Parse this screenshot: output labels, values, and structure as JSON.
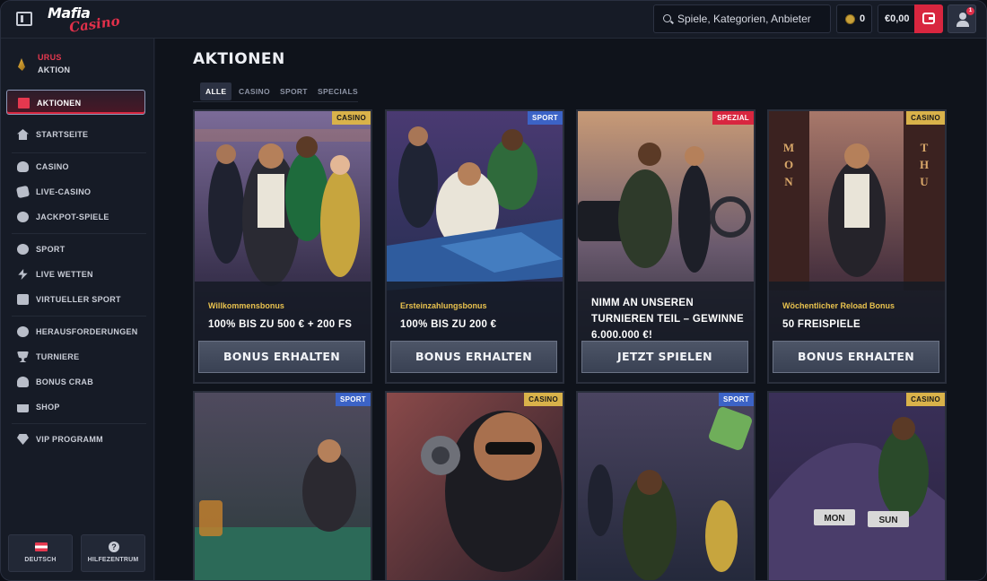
{
  "header": {
    "logo_main": "Mafia",
    "logo_script": "Casino",
    "search_placeholder": "Spiele, Kategorien, Anbieter",
    "coins": "0",
    "balance": "€0,00",
    "notification_count": "1"
  },
  "sidebar": {
    "promo": {
      "top": "URUS",
      "bottom": "AKTION"
    },
    "items": [
      {
        "label": "AKTIONEN",
        "icon": "gift-icon"
      },
      {
        "label": "STARTSEITE",
        "icon": "home-icon"
      },
      {
        "label": "CASINO",
        "icon": "club-icon"
      },
      {
        "label": "LIVE-CASINO",
        "icon": "dice-icon"
      },
      {
        "label": "JACKPOT-SPIELE",
        "icon": "cherry-icon"
      },
      {
        "label": "SPORT",
        "icon": "ball-icon"
      },
      {
        "label": "LIVE WETTEN",
        "icon": "bolt-icon"
      },
      {
        "label": "VIRTUELLER SPORT",
        "icon": "monitor-icon"
      },
      {
        "label": "HERAUSFORDERUNGEN",
        "icon": "gear-icon"
      },
      {
        "label": "TURNIERE",
        "icon": "trophy-icon"
      },
      {
        "label": "BONUS CRAB",
        "icon": "crab-icon"
      },
      {
        "label": "SHOP",
        "icon": "shop-icon"
      },
      {
        "label": "VIP PROGRAMM",
        "icon": "diamond-icon"
      }
    ],
    "language_label": "DEUTSCH",
    "help_label": "HILFEZENTRUM"
  },
  "main": {
    "title": "AKTIONEN",
    "filters": [
      "ALLE",
      "CASINO",
      "SPORT",
      "SPECIALS"
    ],
    "cards": [
      {
        "tag": "CASINO",
        "subtitle": "Willkommensbonus",
        "headline": "100% BIS ZU 500 € + 200 FS",
        "button": "BONUS ERHALTEN"
      },
      {
        "tag": "SPORT",
        "subtitle": "Ersteinzahlungsbonus",
        "headline": "100% BIS ZU 200 €",
        "button": "BONUS ERHALTEN"
      },
      {
        "tag": "SPEZIAL",
        "subtitle": "",
        "headline": "NIMM AN UNSEREN TURNIEREN TEIL – GEWINNE 6.000.000 €!",
        "button": "JETZT SPIELEN"
      },
      {
        "tag": "CASINO",
        "subtitle": "Wöchentlicher Reload Bonus",
        "headline": "50 FREISPIELE",
        "button": "BONUS ERHALTEN"
      },
      {
        "tag": "SPORT"
      },
      {
        "tag": "CASINO"
      },
      {
        "tag": "SPORT"
      },
      {
        "tag": "CASINO"
      }
    ],
    "door_text_left": "MON",
    "door_text_right": "THU",
    "plate_text_left": "MON",
    "plate_text_right": "SUN"
  },
  "colors": {
    "accent": "#d8263f",
    "gold": "#d9b24a",
    "sport_tag": "#3c63c6",
    "background": "#0f131b"
  }
}
